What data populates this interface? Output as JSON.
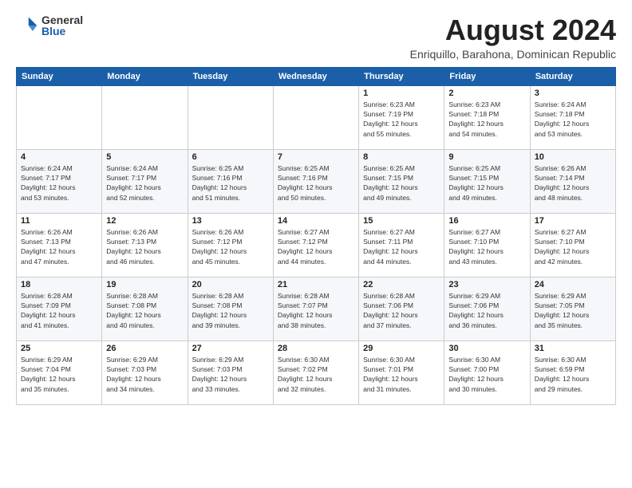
{
  "logo": {
    "general": "General",
    "blue": "Blue"
  },
  "title": "August 2024",
  "subtitle": "Enriquillo, Barahona, Dominican Republic",
  "days_of_week": [
    "Sunday",
    "Monday",
    "Tuesday",
    "Wednesday",
    "Thursday",
    "Friday",
    "Saturday"
  ],
  "rows": [
    [
      {
        "num": "",
        "info": ""
      },
      {
        "num": "",
        "info": ""
      },
      {
        "num": "",
        "info": ""
      },
      {
        "num": "",
        "info": ""
      },
      {
        "num": "1",
        "info": "Sunrise: 6:23 AM\nSunset: 7:19 PM\nDaylight: 12 hours\nand 55 minutes."
      },
      {
        "num": "2",
        "info": "Sunrise: 6:23 AM\nSunset: 7:18 PM\nDaylight: 12 hours\nand 54 minutes."
      },
      {
        "num": "3",
        "info": "Sunrise: 6:24 AM\nSunset: 7:18 PM\nDaylight: 12 hours\nand 53 minutes."
      }
    ],
    [
      {
        "num": "4",
        "info": "Sunrise: 6:24 AM\nSunset: 7:17 PM\nDaylight: 12 hours\nand 53 minutes."
      },
      {
        "num": "5",
        "info": "Sunrise: 6:24 AM\nSunset: 7:17 PM\nDaylight: 12 hours\nand 52 minutes."
      },
      {
        "num": "6",
        "info": "Sunrise: 6:25 AM\nSunset: 7:16 PM\nDaylight: 12 hours\nand 51 minutes."
      },
      {
        "num": "7",
        "info": "Sunrise: 6:25 AM\nSunset: 7:16 PM\nDaylight: 12 hours\nand 50 minutes."
      },
      {
        "num": "8",
        "info": "Sunrise: 6:25 AM\nSunset: 7:15 PM\nDaylight: 12 hours\nand 49 minutes."
      },
      {
        "num": "9",
        "info": "Sunrise: 6:25 AM\nSunset: 7:15 PM\nDaylight: 12 hours\nand 49 minutes."
      },
      {
        "num": "10",
        "info": "Sunrise: 6:26 AM\nSunset: 7:14 PM\nDaylight: 12 hours\nand 48 minutes."
      }
    ],
    [
      {
        "num": "11",
        "info": "Sunrise: 6:26 AM\nSunset: 7:13 PM\nDaylight: 12 hours\nand 47 minutes."
      },
      {
        "num": "12",
        "info": "Sunrise: 6:26 AM\nSunset: 7:13 PM\nDaylight: 12 hours\nand 46 minutes."
      },
      {
        "num": "13",
        "info": "Sunrise: 6:26 AM\nSunset: 7:12 PM\nDaylight: 12 hours\nand 45 minutes."
      },
      {
        "num": "14",
        "info": "Sunrise: 6:27 AM\nSunset: 7:12 PM\nDaylight: 12 hours\nand 44 minutes."
      },
      {
        "num": "15",
        "info": "Sunrise: 6:27 AM\nSunset: 7:11 PM\nDaylight: 12 hours\nand 44 minutes."
      },
      {
        "num": "16",
        "info": "Sunrise: 6:27 AM\nSunset: 7:10 PM\nDaylight: 12 hours\nand 43 minutes."
      },
      {
        "num": "17",
        "info": "Sunrise: 6:27 AM\nSunset: 7:10 PM\nDaylight: 12 hours\nand 42 minutes."
      }
    ],
    [
      {
        "num": "18",
        "info": "Sunrise: 6:28 AM\nSunset: 7:09 PM\nDaylight: 12 hours\nand 41 minutes."
      },
      {
        "num": "19",
        "info": "Sunrise: 6:28 AM\nSunset: 7:08 PM\nDaylight: 12 hours\nand 40 minutes."
      },
      {
        "num": "20",
        "info": "Sunrise: 6:28 AM\nSunset: 7:08 PM\nDaylight: 12 hours\nand 39 minutes."
      },
      {
        "num": "21",
        "info": "Sunrise: 6:28 AM\nSunset: 7:07 PM\nDaylight: 12 hours\nand 38 minutes."
      },
      {
        "num": "22",
        "info": "Sunrise: 6:28 AM\nSunset: 7:06 PM\nDaylight: 12 hours\nand 37 minutes."
      },
      {
        "num": "23",
        "info": "Sunrise: 6:29 AM\nSunset: 7:06 PM\nDaylight: 12 hours\nand 36 minutes."
      },
      {
        "num": "24",
        "info": "Sunrise: 6:29 AM\nSunset: 7:05 PM\nDaylight: 12 hours\nand 35 minutes."
      }
    ],
    [
      {
        "num": "25",
        "info": "Sunrise: 6:29 AM\nSunset: 7:04 PM\nDaylight: 12 hours\nand 35 minutes."
      },
      {
        "num": "26",
        "info": "Sunrise: 6:29 AM\nSunset: 7:03 PM\nDaylight: 12 hours\nand 34 minutes."
      },
      {
        "num": "27",
        "info": "Sunrise: 6:29 AM\nSunset: 7:03 PM\nDaylight: 12 hours\nand 33 minutes."
      },
      {
        "num": "28",
        "info": "Sunrise: 6:30 AM\nSunset: 7:02 PM\nDaylight: 12 hours\nand 32 minutes."
      },
      {
        "num": "29",
        "info": "Sunrise: 6:30 AM\nSunset: 7:01 PM\nDaylight: 12 hours\nand 31 minutes."
      },
      {
        "num": "30",
        "info": "Sunrise: 6:30 AM\nSunset: 7:00 PM\nDaylight: 12 hours\nand 30 minutes."
      },
      {
        "num": "31",
        "info": "Sunrise: 6:30 AM\nSunset: 6:59 PM\nDaylight: 12 hours\nand 29 minutes."
      }
    ]
  ]
}
